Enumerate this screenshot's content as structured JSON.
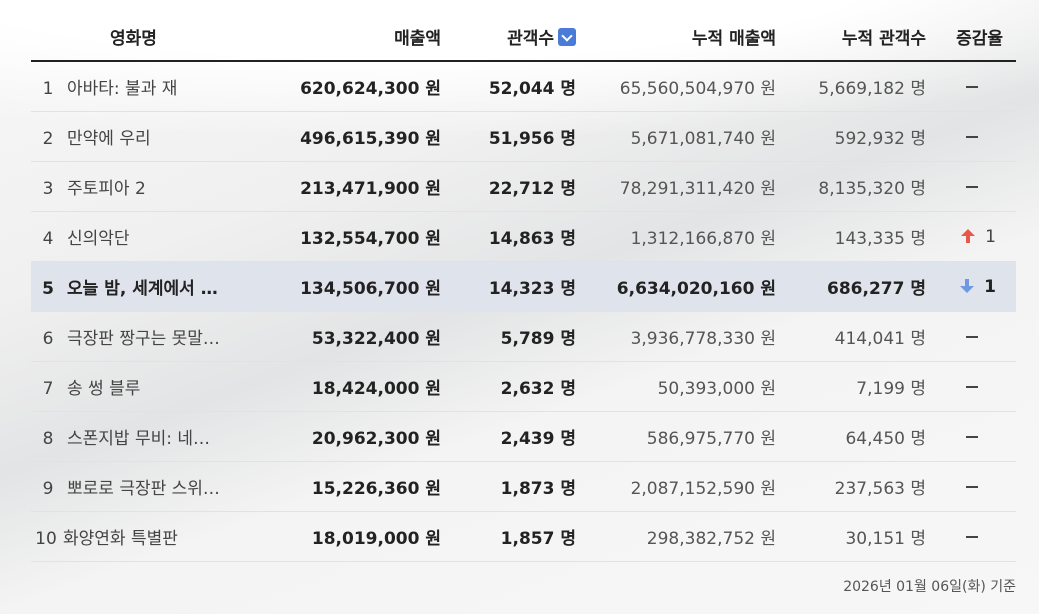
{
  "headers": {
    "title": "영화명",
    "sales": "매출액",
    "audience": "관객수",
    "cum_sales": "누적 매출액",
    "cum_audience": "누적 관객수",
    "change": "증감율"
  },
  "rows": [
    {
      "rank": "1",
      "title": "아바타: 불과 재",
      "sales": "620,624,300 원",
      "audience": "52,044 명",
      "cum_sales": "65,560,504,970 원",
      "cum_audience": "5,669,182 명",
      "change": {
        "dir": "none",
        "value": ""
      }
    },
    {
      "rank": "2",
      "title": "만약에 우리",
      "sales": "496,615,390 원",
      "audience": "51,956 명",
      "cum_sales": "5,671,081,740 원",
      "cum_audience": "592,932 명",
      "change": {
        "dir": "none",
        "value": ""
      }
    },
    {
      "rank": "3",
      "title": "주토피아 2",
      "sales": "213,471,900 원",
      "audience": "22,712 명",
      "cum_sales": "78,291,311,420 원",
      "cum_audience": "8,135,320 명",
      "change": {
        "dir": "none",
        "value": ""
      }
    },
    {
      "rank": "4",
      "title": "신의악단",
      "sales": "132,554,700 원",
      "audience": "14,863 명",
      "cum_sales": "1,312,166,870 원",
      "cum_audience": "143,335 명",
      "change": {
        "dir": "up",
        "value": "1"
      }
    },
    {
      "rank": "5",
      "title": "오늘 밤, 세계에서 …",
      "sales": "134,506,700 원",
      "audience": "14,323 명",
      "cum_sales": "6,634,020,160 원",
      "cum_audience": "686,277 명",
      "change": {
        "dir": "down",
        "value": "1"
      },
      "highlight": true
    },
    {
      "rank": "6",
      "title": "극장판 짱구는 못말…",
      "sales": "53,322,400 원",
      "audience": "5,789 명",
      "cum_sales": "3,936,778,330 원",
      "cum_audience": "414,041 명",
      "change": {
        "dir": "none",
        "value": ""
      }
    },
    {
      "rank": "7",
      "title": "송 썽 블루",
      "sales": "18,424,000 원",
      "audience": "2,632 명",
      "cum_sales": "50,393,000 원",
      "cum_audience": "7,199 명",
      "change": {
        "dir": "none",
        "value": ""
      }
    },
    {
      "rank": "8",
      "title": "스폰지밥 무비: 네…",
      "sales": "20,962,300 원",
      "audience": "2,439 명",
      "cum_sales": "586,975,770 원",
      "cum_audience": "64,450 명",
      "change": {
        "dir": "none",
        "value": ""
      }
    },
    {
      "rank": "9",
      "title": "뽀로로 극장판 스위…",
      "sales": "15,226,360 원",
      "audience": "1,873 명",
      "cum_sales": "2,087,152,590 원",
      "cum_audience": "237,563 명",
      "change": {
        "dir": "none",
        "value": ""
      }
    },
    {
      "rank": "10",
      "title": "화양연화 특별판",
      "sales": "18,019,000 원",
      "audience": "1,857 명",
      "cum_sales": "298,382,752 원",
      "cum_audience": "30,151 명",
      "change": {
        "dir": "none",
        "value": ""
      }
    }
  ],
  "footnote": "2026년 01월 06일(화) 기준",
  "colors": {
    "highlight_row": "#dfe3ec",
    "sort_button": "#4a7bd8",
    "rank_up": "#e8584a",
    "rank_down": "#6f98e0"
  }
}
